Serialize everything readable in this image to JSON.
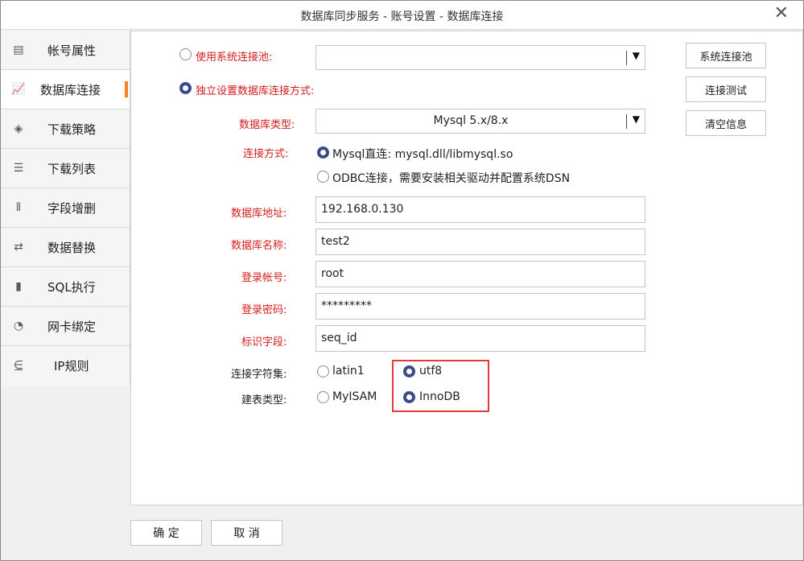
{
  "window": {
    "title": "数据库同步服务 - 账号设置 - 数据库连接",
    "close_glyph": "✕"
  },
  "sidebar": {
    "items": [
      {
        "label": "帐号属性",
        "icon": "account-card-icon",
        "glyph": "▤"
      },
      {
        "label": "数据库连接",
        "icon": "database-chart-icon",
        "glyph": "📈",
        "active": true
      },
      {
        "label": "下载策略",
        "icon": "diamond-icon",
        "glyph": "◈"
      },
      {
        "label": "下载列表",
        "icon": "list-icon",
        "glyph": "☰"
      },
      {
        "label": "字段增删",
        "icon": "field-columns-icon",
        "glyph": "⦀"
      },
      {
        "label": "数据替换",
        "icon": "replace-icon",
        "glyph": "⇄"
      },
      {
        "label": "SQL执行",
        "icon": "bar-chart-icon",
        "glyph": "▮"
      },
      {
        "label": "网卡绑定",
        "icon": "pie-chart-icon",
        "glyph": "◔"
      },
      {
        "label": "IP规则",
        "icon": "ip-rule-icon",
        "glyph": "⋸"
      }
    ]
  },
  "form": {
    "use_pool_label": "使用系统连接池:",
    "pool_value": "",
    "independent_label": "独立设置数据库连接方式:",
    "db_type_label": "数据库类型:",
    "db_type_value": "Mysql 5.x/8.x",
    "conn_method_label": "连接方式:",
    "conn_mysql_label": "Mysql直连: mysql.dll/libmysql.so",
    "conn_odbc_label": "ODBC连接，需要安装相关驱动并配置系统DSN",
    "db_address_label": "数据库地址:",
    "db_address_value": "192.168.0.130",
    "db_name_label": "数据库名称:",
    "db_name_value": "test2",
    "login_account_label": "登录帐号:",
    "login_account_value": "root",
    "login_password_label": "登录密码:",
    "login_password_value": "*********",
    "id_field_label": "标识字段:",
    "id_field_value": "seq_id",
    "charset_label": "连接字符集:",
    "charset_latin1": "latin1",
    "charset_utf8": "utf8",
    "table_type_label": "建表类型:",
    "table_myisam": "MyISAM",
    "table_innodb": "InnoDB",
    "arrow_glyph": "▼"
  },
  "side_buttons": {
    "pool": "系统连接池",
    "test": "连接测试",
    "clear": "清空信息"
  },
  "footer": {
    "ok": "确 定",
    "cancel": "取 消"
  },
  "colors": {
    "accent": "#f58220",
    "required_label": "#d21e1e",
    "radio_checked": "#3b4a8c",
    "highlight": "#e23a3a"
  }
}
